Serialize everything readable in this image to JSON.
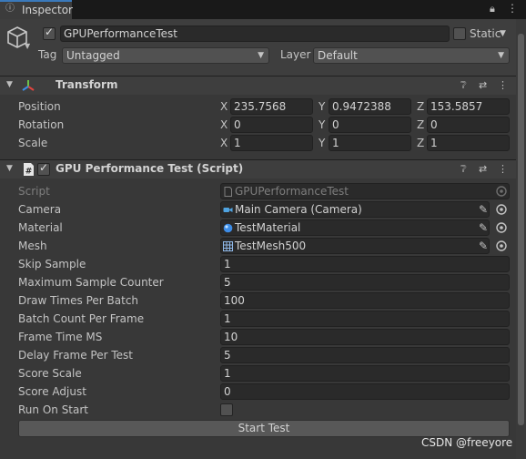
{
  "window": {
    "tab_label": "Inspector",
    "tab_icon": "info-icon",
    "lock_icon": "lock-icon",
    "menu_icon": "kebab-menu-icon"
  },
  "gameobject": {
    "active": true,
    "name": "GPUPerformanceTest",
    "static_label": "Static",
    "tag_label": "Tag",
    "tag_value": "Untagged",
    "layer_label": "Layer",
    "layer_value": "Default"
  },
  "transform": {
    "title": "Transform",
    "rows": [
      {
        "label": "Position",
        "x": "235.7568",
        "y": "0.9472388",
        "z": "153.5857"
      },
      {
        "label": "Rotation",
        "x": "0",
        "y": "0",
        "z": "0"
      },
      {
        "label": "Scale",
        "x": "1",
        "y": "1",
        "z": "1"
      }
    ],
    "axis": {
      "x": "X",
      "y": "Y",
      "z": "Z"
    }
  },
  "script_component": {
    "enabled": true,
    "title": "GPU Performance Test (Script)",
    "script_label": "Script",
    "script_value": "GPUPerformanceTest",
    "camera_label": "Camera",
    "camera_value": "Main Camera (Camera)",
    "material_label": "Material",
    "material_value": "TestMaterial",
    "mesh_label": "Mesh",
    "mesh_value": "TestMesh500",
    "fields": [
      {
        "label": "Skip Sample",
        "value": "1"
      },
      {
        "label": "Maximum Sample Counter",
        "value": "5"
      },
      {
        "label": "Draw Times Per Batch",
        "value": "100"
      },
      {
        "label": "Batch Count Per Frame",
        "value": "1"
      },
      {
        "label": "Frame Time MS",
        "value": "10"
      },
      {
        "label": "Delay Frame Per Test",
        "value": "5"
      },
      {
        "label": "Score Scale",
        "value": "1"
      },
      {
        "label": "Score Adjust",
        "value": "0"
      }
    ],
    "run_on_start_label": "Run On Start",
    "run_on_start": false,
    "start_button": "Start Test"
  },
  "watermark": "CSDN @freeyore",
  "colors": {
    "accent": "#3a79bb",
    "field_bg": "#2a2a2a",
    "panel_bg": "#383838"
  }
}
